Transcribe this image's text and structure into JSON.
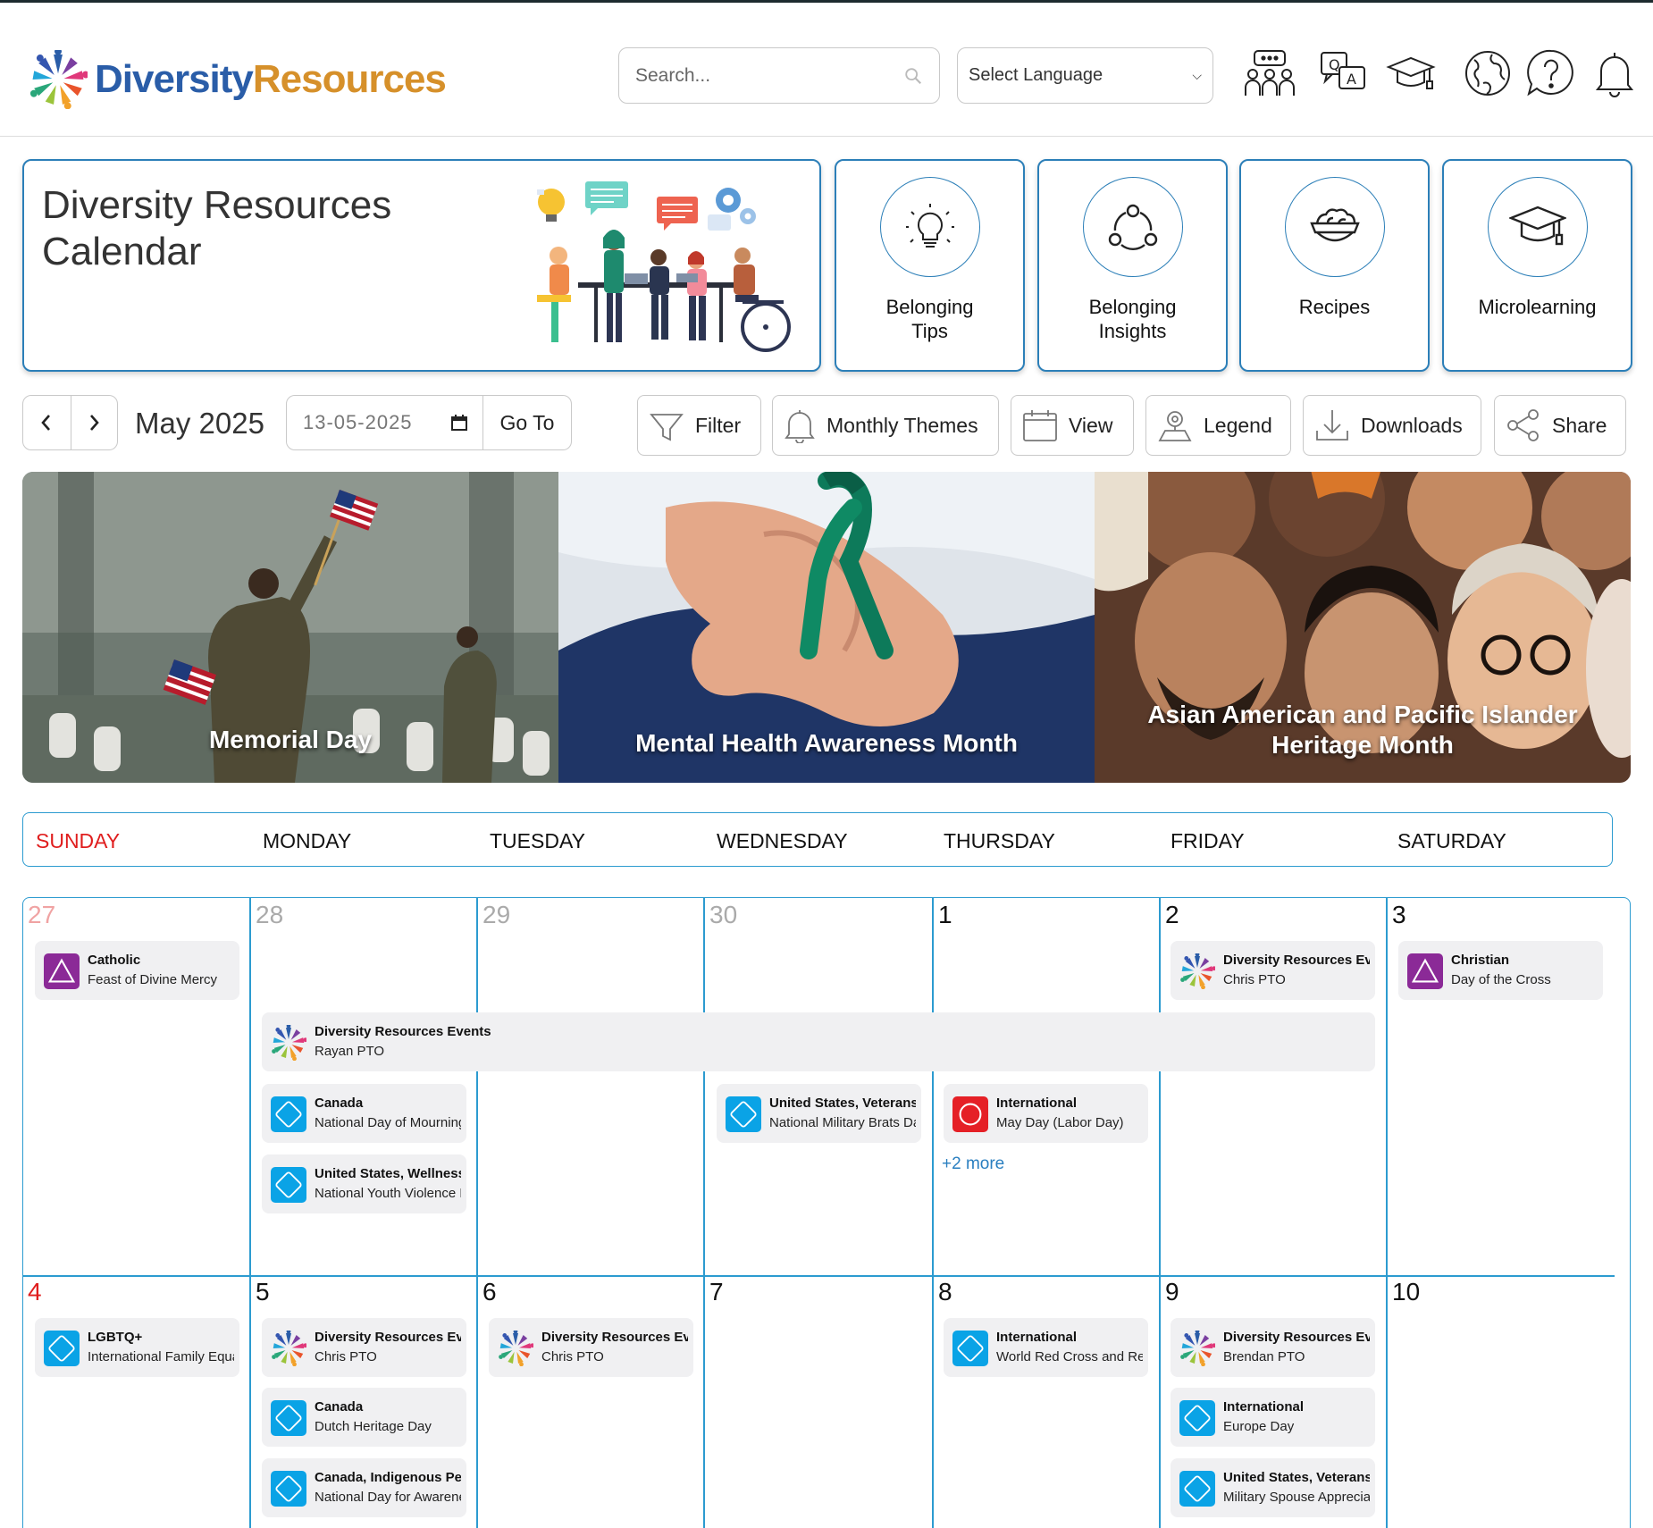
{
  "brand": {
    "name_part1": "Diversity",
    "name_part2": "Resources"
  },
  "header": {
    "search_placeholder": "Search...",
    "language_select": "Select Language",
    "icons": [
      "community-icon",
      "translate-icon",
      "graduation-cap-icon",
      "globe-icon",
      "help-icon",
      "bell-icon"
    ]
  },
  "hero": {
    "title_line1": "Diversity Resources",
    "title_line2": "Calendar",
    "features": [
      {
        "line1": "Belonging",
        "line2": "Tips",
        "icon": "lightbulb-icon"
      },
      {
        "line1": "Belonging",
        "line2": "Insights",
        "icon": "network-icon"
      },
      {
        "line1": "Recipes",
        "line2": "",
        "icon": "salad-bowl-icon"
      },
      {
        "line1": "Microlearning",
        "line2": "",
        "icon": "graduation-cap-icon"
      }
    ]
  },
  "toolbar": {
    "month_label": "May 2025",
    "date_value": "13-05-2025",
    "goto_label": "Go To",
    "buttons": [
      "Filter",
      "Monthly Themes",
      "View",
      "Legend",
      "Downloads",
      "Share"
    ]
  },
  "banners": [
    {
      "title": "Memorial Day"
    },
    {
      "title": "Mental Health Awareness Month"
    },
    {
      "title_line1": "Asian American and Pacific Islander",
      "title_line2": "Heritage Month"
    }
  ],
  "weekdays": [
    "SUNDAY",
    "MONDAY",
    "TUESDAY",
    "WEDNESDAY",
    "THURSDAY",
    "FRIDAY",
    "SATURDAY"
  ],
  "week1": {
    "days": [
      "27",
      "28",
      "29",
      "30",
      "1",
      "2",
      "3"
    ],
    "events": {
      "sun_catholic": {
        "title": "Catholic",
        "subtitle": "Feast of Divine Mercy"
      },
      "fri_dr": {
        "title": "Diversity Resources Events",
        "subtitle": "Chris PTO"
      },
      "sat_christian": {
        "title": "Christian",
        "subtitle": "Day of the Cross"
      },
      "span_dr": {
        "title": "Diversity Resources Events",
        "subtitle": "Rayan PTO"
      },
      "mon_canada": {
        "title": "Canada",
        "subtitle": "National Day of Mourning"
      },
      "mon_us_wellness": {
        "title": "United States, Wellness",
        "subtitle": "National Youth Violence Prevention Week"
      },
      "wed_us_veterans": {
        "title": "United States, Veterans",
        "subtitle": "National Military Brats Day"
      },
      "thu_intl": {
        "title": "International",
        "subtitle": "May Day (Labor Day)"
      },
      "thu_more": "+2 more"
    }
  },
  "week2": {
    "days": [
      "4",
      "5",
      "6",
      "7",
      "8",
      "9",
      "10"
    ],
    "events": {
      "sun_lgbtq": {
        "title": "LGBTQ+",
        "subtitle": "International Family Equality Day"
      },
      "mon_dr": {
        "title": "Diversity Resources Events",
        "subtitle": "Chris PTO"
      },
      "mon_canada": {
        "title": "Canada",
        "subtitle": "Dutch Heritage Day"
      },
      "mon_canada_indig": {
        "title": "Canada, Indigenous Peoples",
        "subtitle": "National Day for Awareness"
      },
      "tue_dr": {
        "title": "Diversity Resources Events",
        "subtitle": "Chris PTO"
      },
      "thu_intl": {
        "title": "International",
        "subtitle": "World Red Cross and Red Crescent Day"
      },
      "fri_dr": {
        "title": "Diversity Resources Events",
        "subtitle": "Brendan PTO"
      },
      "fri_intl": {
        "title": "International",
        "subtitle": "Europe Day"
      },
      "fri_us_veterans": {
        "title": "United States, Veterans",
        "subtitle": "Military Spouse Appreciation Day"
      }
    }
  },
  "colors": {
    "accent": "#2c9bd0",
    "sunday": "#e01e1e",
    "event_blue": "#0aa3e6",
    "event_purple": "#8b2a97",
    "event_red": "#e52026"
  }
}
